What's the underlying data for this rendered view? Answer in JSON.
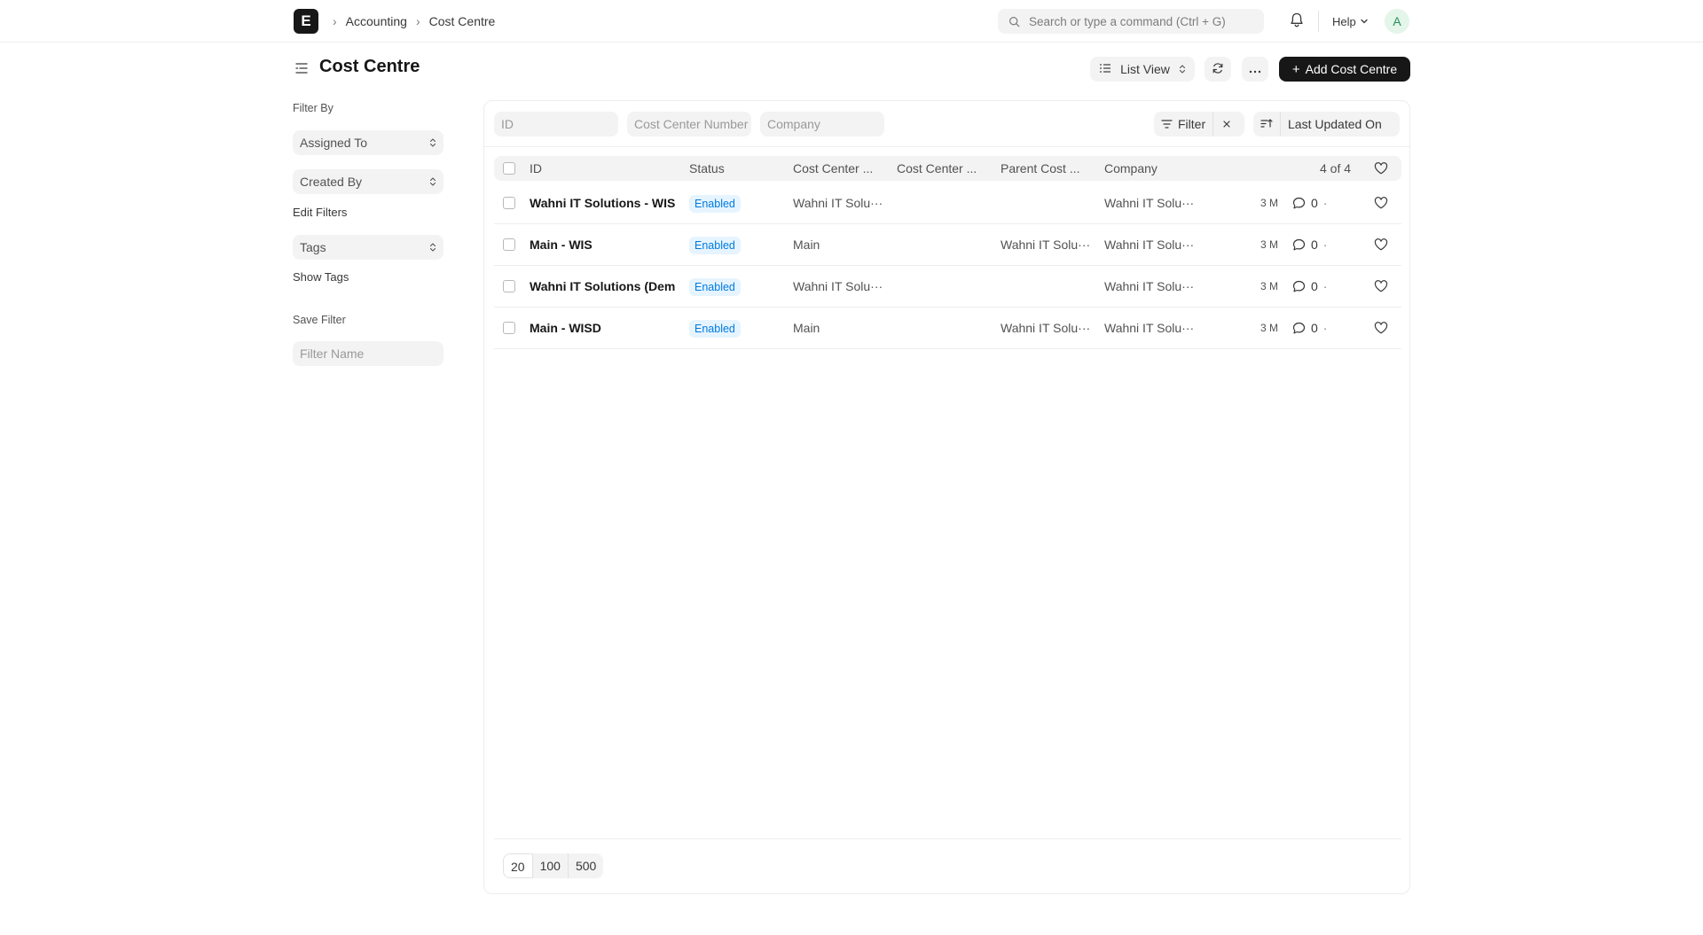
{
  "app": {
    "logo_letter": "E"
  },
  "breadcrumbs": [
    {
      "label": "Accounting"
    },
    {
      "label": "Cost Centre"
    }
  ],
  "search": {
    "placeholder": "Search or type a command (Ctrl + G)"
  },
  "help": {
    "label": "Help"
  },
  "user": {
    "avatar_letter": "A"
  },
  "page": {
    "title": "Cost Centre"
  },
  "toolbar": {
    "view_label": "List View",
    "add_label": "Add Cost Centre"
  },
  "sidebar": {
    "filter_by_label": "Filter By",
    "assigned_to": "Assigned To",
    "created_by": "Created By",
    "edit_filters": "Edit Filters",
    "tags": "Tags",
    "show_tags": "Show Tags",
    "save_filter_label": "Save Filter",
    "filter_name_placeholder": "Filter Name"
  },
  "filters": {
    "id_placeholder": "ID",
    "cost_center_number_placeholder": "Cost Center Number",
    "company_placeholder": "Company",
    "filter_label": "Filter",
    "sort_label": "Last Updated On"
  },
  "table": {
    "headers": {
      "id": "ID",
      "status": "Status",
      "cost_center_name": "Cost Center ...",
      "cost_center_number": "Cost Center ...",
      "parent_cost_center": "Parent Cost ...",
      "company": "Company",
      "count": "4 of 4"
    },
    "rows": [
      {
        "id": "Wahni IT Solutions - WIS",
        "status": "Enabled",
        "cost_center_name": "Wahni IT Solu···",
        "parent": "",
        "company": "Wahni IT Solu···",
        "modified": "3 M",
        "comments": "0"
      },
      {
        "id": "Main - WIS",
        "status": "Enabled",
        "cost_center_name": "Main",
        "parent": "Wahni IT Solu···",
        "company": "Wahni IT Solu···",
        "modified": "3 M",
        "comments": "0"
      },
      {
        "id": "Wahni IT Solutions (Demo)",
        "status": "Enabled",
        "cost_center_name": "Wahni IT Solu···",
        "parent": "",
        "company": "Wahni IT Solu···",
        "modified": "3 M",
        "comments": "0"
      },
      {
        "id": "Main - WISD",
        "status": "Enabled",
        "cost_center_name": "Main",
        "parent": "Wahni IT Solu···",
        "company": "Wahni IT Solu···",
        "modified": "3 M",
        "comments": "0"
      }
    ]
  },
  "paging": {
    "sizes": [
      "20",
      "100",
      "500"
    ],
    "selected": "20"
  },
  "colors": {
    "primary_button": "#171717",
    "badge_bg": "#e6f4ff",
    "badge_text": "#007be0"
  }
}
